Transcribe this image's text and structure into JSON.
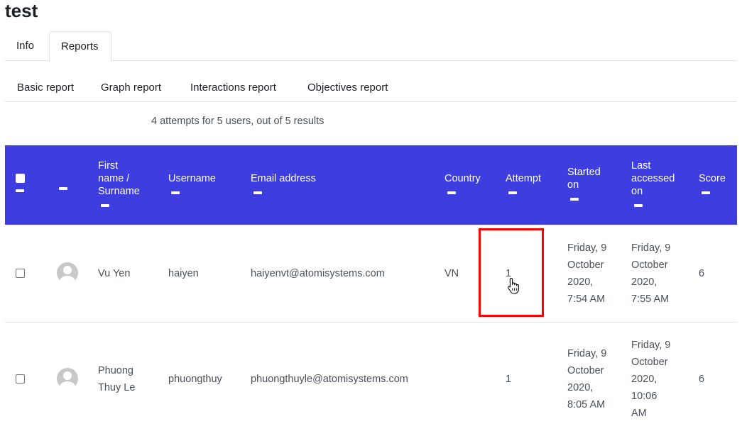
{
  "page": {
    "title": "test"
  },
  "tabs": [
    {
      "label": "Info"
    },
    {
      "label": "Reports"
    }
  ],
  "subtabs": [
    {
      "label": "Basic report"
    },
    {
      "label": "Graph report"
    },
    {
      "label": "Interactions report"
    },
    {
      "label": "Objectives report"
    }
  ],
  "summary": "4 attempts for 5 users, out of 5 results",
  "table": {
    "header_bg": "#3d3de0",
    "columns": {
      "name_1": "First",
      "name_2": "name /",
      "name_3": "Surname",
      "username": "Username",
      "email": "Email address",
      "country": "Country",
      "attempt": "Attempt",
      "started_1": "Started",
      "started_2": "on",
      "last_1": "Last",
      "last_2": "accessed",
      "last_3": "on",
      "score": "Score"
    },
    "rows": [
      {
        "name_1": "Vu Yen",
        "username": "haiyen",
        "email": "haiyenvt@atomisystems.com",
        "country": "VN",
        "attempt": "1",
        "started": [
          "Friday, 9",
          "October",
          "2020,",
          "7:54 AM"
        ],
        "last": [
          "Friday, 9",
          "October",
          "2020,",
          "7:55 AM"
        ],
        "score": "6"
      },
      {
        "name_1": "Phuong",
        "name_2": "Thuy Le",
        "username": "phuongthuy",
        "email": "phuongthuyle@atomisystems.com",
        "country": "",
        "attempt": "1",
        "started": [
          "Friday, 9",
          "October",
          "2020,",
          "8:05 AM"
        ],
        "last": [
          "Friday, 9",
          "October",
          "2020,",
          "10:06",
          "AM"
        ],
        "score": "6"
      }
    ]
  },
  "annotation": {
    "color": "#ff0000"
  }
}
